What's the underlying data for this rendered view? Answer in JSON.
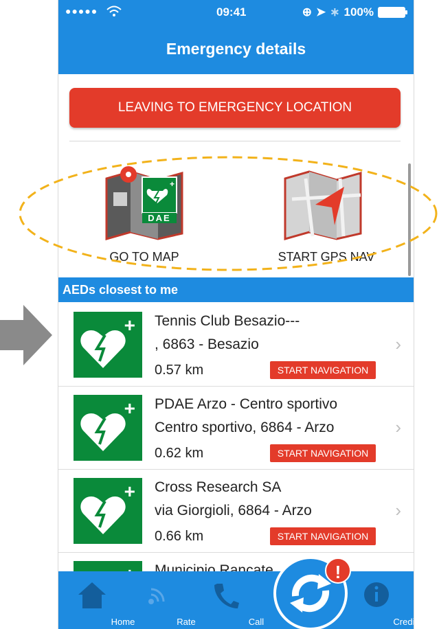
{
  "status_bar": {
    "signal": "●●●●●",
    "time": "09:41",
    "battery": "100%"
  },
  "header": {
    "title": "Emergency details"
  },
  "leave_button": "LEAVING TO EMERGENCY LOCATION",
  "quick_actions": [
    {
      "label": "GO TO MAP",
      "badge": "DAE",
      "icon": "map-marker-icon"
    },
    {
      "label": "START GPS NAV",
      "icon": "navigation-arrow-icon"
    }
  ],
  "section_title": "AEDs closest to me",
  "aeds": [
    {
      "name": "Tennis Club Besazio---",
      "address": ", 6863 - Besazio",
      "distance": "0.57 km",
      "action": "START NAVIGATION"
    },
    {
      "name": "PDAE Arzo - Centro sportivo",
      "address": "Centro sportivo, 6864 - Arzo",
      "distance": "0.62 km",
      "action": "START NAVIGATION"
    },
    {
      "name": "Cross Research SA",
      "address": "via Giorgioli, 6864 - Arzo",
      "distance": "0.66 km",
      "action": "START NAVIGATION"
    },
    {
      "name": "Municipio Rancate",
      "address": "",
      "distance": "",
      "action": ""
    }
  ],
  "tabs": [
    {
      "label": "Home",
      "icon": "home-icon"
    },
    {
      "label": "Rate",
      "icon": "broadcast-icon"
    },
    {
      "label": "Call",
      "icon": "phone-icon"
    },
    {
      "label": "Credits",
      "icon": "info-icon"
    }
  ],
  "fab": {
    "icon": "refresh-icon",
    "badge": "!"
  },
  "colors": {
    "primary": "#1e8be0",
    "danger": "#e33b2a",
    "aed_green": "#0a8a3a",
    "highlight": "#f2b21a"
  }
}
